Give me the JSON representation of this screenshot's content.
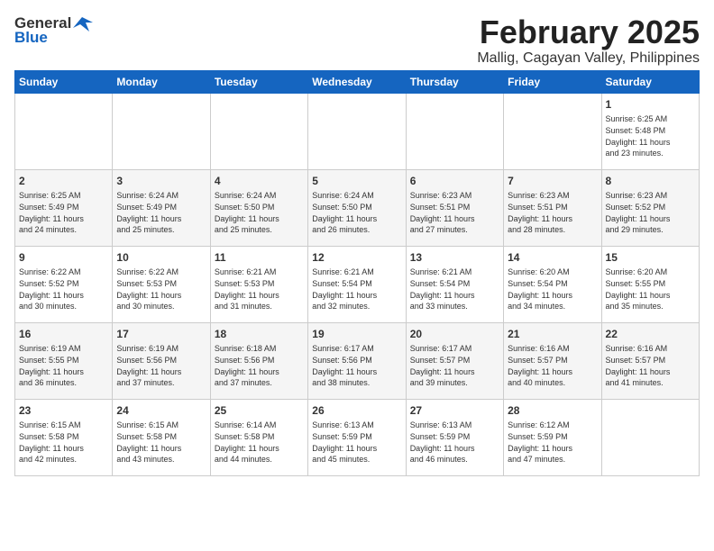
{
  "logo": {
    "general": "General",
    "blue": "Blue"
  },
  "title": "February 2025",
  "subtitle": "Mallig, Cagayan Valley, Philippines",
  "days_of_week": [
    "Sunday",
    "Monday",
    "Tuesday",
    "Wednesday",
    "Thursday",
    "Friday",
    "Saturday"
  ],
  "weeks": [
    [
      {
        "day": "",
        "info": ""
      },
      {
        "day": "",
        "info": ""
      },
      {
        "day": "",
        "info": ""
      },
      {
        "day": "",
        "info": ""
      },
      {
        "day": "",
        "info": ""
      },
      {
        "day": "",
        "info": ""
      },
      {
        "day": "1",
        "info": "Sunrise: 6:25 AM\nSunset: 5:48 PM\nDaylight: 11 hours\nand 23 minutes."
      }
    ],
    [
      {
        "day": "2",
        "info": "Sunrise: 6:25 AM\nSunset: 5:49 PM\nDaylight: 11 hours\nand 24 minutes."
      },
      {
        "day": "3",
        "info": "Sunrise: 6:24 AM\nSunset: 5:49 PM\nDaylight: 11 hours\nand 25 minutes."
      },
      {
        "day": "4",
        "info": "Sunrise: 6:24 AM\nSunset: 5:50 PM\nDaylight: 11 hours\nand 25 minutes."
      },
      {
        "day": "5",
        "info": "Sunrise: 6:24 AM\nSunset: 5:50 PM\nDaylight: 11 hours\nand 26 minutes."
      },
      {
        "day": "6",
        "info": "Sunrise: 6:23 AM\nSunset: 5:51 PM\nDaylight: 11 hours\nand 27 minutes."
      },
      {
        "day": "7",
        "info": "Sunrise: 6:23 AM\nSunset: 5:51 PM\nDaylight: 11 hours\nand 28 minutes."
      },
      {
        "day": "8",
        "info": "Sunrise: 6:23 AM\nSunset: 5:52 PM\nDaylight: 11 hours\nand 29 minutes."
      }
    ],
    [
      {
        "day": "9",
        "info": "Sunrise: 6:22 AM\nSunset: 5:52 PM\nDaylight: 11 hours\nand 30 minutes."
      },
      {
        "day": "10",
        "info": "Sunrise: 6:22 AM\nSunset: 5:53 PM\nDaylight: 11 hours\nand 30 minutes."
      },
      {
        "day": "11",
        "info": "Sunrise: 6:21 AM\nSunset: 5:53 PM\nDaylight: 11 hours\nand 31 minutes."
      },
      {
        "day": "12",
        "info": "Sunrise: 6:21 AM\nSunset: 5:54 PM\nDaylight: 11 hours\nand 32 minutes."
      },
      {
        "day": "13",
        "info": "Sunrise: 6:21 AM\nSunset: 5:54 PM\nDaylight: 11 hours\nand 33 minutes."
      },
      {
        "day": "14",
        "info": "Sunrise: 6:20 AM\nSunset: 5:54 PM\nDaylight: 11 hours\nand 34 minutes."
      },
      {
        "day": "15",
        "info": "Sunrise: 6:20 AM\nSunset: 5:55 PM\nDaylight: 11 hours\nand 35 minutes."
      }
    ],
    [
      {
        "day": "16",
        "info": "Sunrise: 6:19 AM\nSunset: 5:55 PM\nDaylight: 11 hours\nand 36 minutes."
      },
      {
        "day": "17",
        "info": "Sunrise: 6:19 AM\nSunset: 5:56 PM\nDaylight: 11 hours\nand 37 minutes."
      },
      {
        "day": "18",
        "info": "Sunrise: 6:18 AM\nSunset: 5:56 PM\nDaylight: 11 hours\nand 37 minutes."
      },
      {
        "day": "19",
        "info": "Sunrise: 6:17 AM\nSunset: 5:56 PM\nDaylight: 11 hours\nand 38 minutes."
      },
      {
        "day": "20",
        "info": "Sunrise: 6:17 AM\nSunset: 5:57 PM\nDaylight: 11 hours\nand 39 minutes."
      },
      {
        "day": "21",
        "info": "Sunrise: 6:16 AM\nSunset: 5:57 PM\nDaylight: 11 hours\nand 40 minutes."
      },
      {
        "day": "22",
        "info": "Sunrise: 6:16 AM\nSunset: 5:57 PM\nDaylight: 11 hours\nand 41 minutes."
      }
    ],
    [
      {
        "day": "23",
        "info": "Sunrise: 6:15 AM\nSunset: 5:58 PM\nDaylight: 11 hours\nand 42 minutes."
      },
      {
        "day": "24",
        "info": "Sunrise: 6:15 AM\nSunset: 5:58 PM\nDaylight: 11 hours\nand 43 minutes."
      },
      {
        "day": "25",
        "info": "Sunrise: 6:14 AM\nSunset: 5:58 PM\nDaylight: 11 hours\nand 44 minutes."
      },
      {
        "day": "26",
        "info": "Sunrise: 6:13 AM\nSunset: 5:59 PM\nDaylight: 11 hours\nand 45 minutes."
      },
      {
        "day": "27",
        "info": "Sunrise: 6:13 AM\nSunset: 5:59 PM\nDaylight: 11 hours\nand 46 minutes."
      },
      {
        "day": "28",
        "info": "Sunrise: 6:12 AM\nSunset: 5:59 PM\nDaylight: 11 hours\nand 47 minutes."
      },
      {
        "day": "",
        "info": ""
      }
    ]
  ]
}
